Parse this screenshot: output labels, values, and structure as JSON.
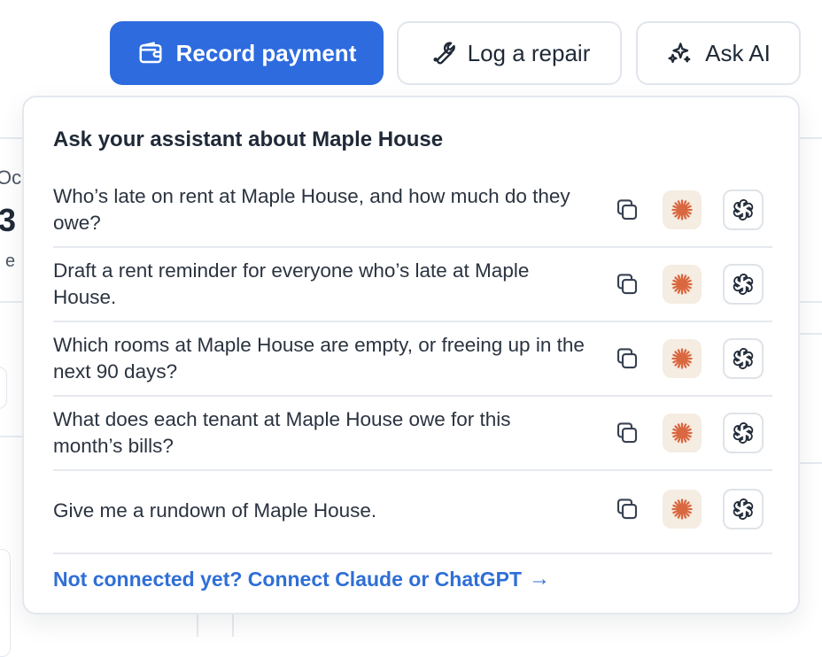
{
  "background": {
    "partial_label": "Oc",
    "partial_number": "3",
    "partial_caption": "l e"
  },
  "toolbar": {
    "record_payment_label": "Record payment",
    "log_repair_label": "Log a repair",
    "ask_ai_label": "Ask AI",
    "primary_color": "#2d6bdf"
  },
  "panel": {
    "title": "Ask your assistant about Maple House",
    "prompts": [
      {
        "text": "Who’s late on rent at Maple House, and how much do they owe?"
      },
      {
        "text": "Draft a rent reminder for everyone who’s late at Maple House."
      },
      {
        "text": "Which rooms at Maple House are empty, or freeing up in the next 90 days?"
      },
      {
        "text": "What does each tenant at Maple House owe for this month’s bills?"
      },
      {
        "text": "Give me a rundown of Maple House."
      }
    ],
    "connect_link": "Not connected yet? Connect Claude or ChatGPT",
    "connect_arrow": "→",
    "claude_accent": "#d9673f",
    "link_color": "#2f6fd6"
  },
  "icons": {
    "record_payment": "wallet-icon",
    "log_repair": "wrench-icon",
    "ask_ai": "sparkles-icon",
    "copy": "copy-icon",
    "claude": "claude-logo-icon",
    "chatgpt": "chatgpt-logo-icon"
  }
}
